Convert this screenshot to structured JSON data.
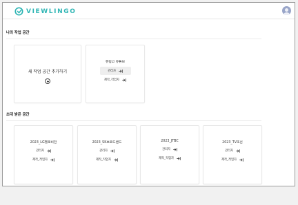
{
  "app": {
    "brand": "VIEWLINGO",
    "brand_color": "#2eb5b4"
  },
  "my_spaces": {
    "title": "나의 작업 공간",
    "add_card": {
      "label": "새 작업 공간 추가하기",
      "icon": "plus-circle-icon"
    },
    "spaces": [
      {
        "name": "뷰링고 유튜브",
        "manager_label": "관리자",
        "maker_label": "제작_작업자"
      }
    ]
  },
  "invited": {
    "title": "초대 받은 공간",
    "spaces": [
      {
        "name": "2023_LG헬로비전",
        "manager_label": "관리자",
        "maker_label": "제작_작업자"
      },
      {
        "name": "2023_SK브로드밴드",
        "manager_label": "관리자",
        "maker_label": "제작_작업자"
      },
      {
        "name": "2023_JTBC",
        "manager_label": "관리자",
        "maker_label": "제작_작업자"
      },
      {
        "name": "2023_TV조선",
        "manager_label": "관리자",
        "maker_label": "제작_작업자"
      }
    ]
  }
}
